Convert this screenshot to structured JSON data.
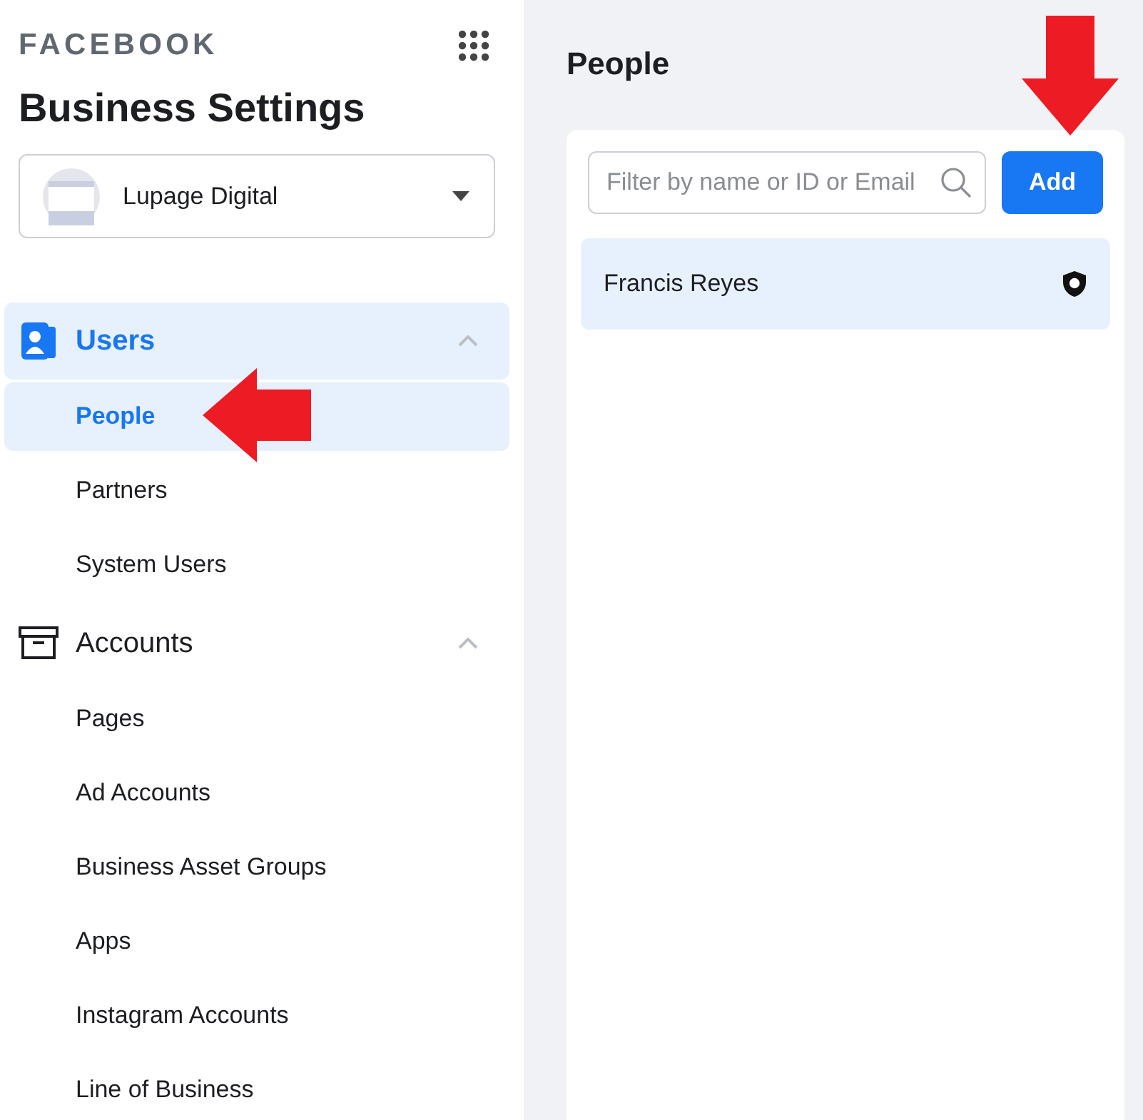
{
  "logo": "FACEBOOK",
  "title": "Business Settings",
  "account": {
    "name": "Lupage Digital"
  },
  "nav": [
    {
      "label": "Users",
      "kind": "users",
      "expanded": true,
      "selected": true,
      "children": [
        {
          "label": "People",
          "selected": true
        },
        {
          "label": "Partners",
          "selected": false
        },
        {
          "label": "System Users",
          "selected": false
        }
      ]
    },
    {
      "label": "Accounts",
      "kind": "accounts",
      "expanded": true,
      "selected": false,
      "children": [
        {
          "label": "Pages",
          "selected": false
        },
        {
          "label": "Ad Accounts",
          "selected": false
        },
        {
          "label": "Business Asset Groups",
          "selected": false
        },
        {
          "label": "Apps",
          "selected": false
        },
        {
          "label": "Instagram Accounts",
          "selected": false
        },
        {
          "label": "Line of Business",
          "selected": false
        }
      ]
    }
  ],
  "main": {
    "heading": "People",
    "search": {
      "placeholder": "Filter by name or ID or Email"
    },
    "add_button": "Add",
    "people": [
      {
        "name": "Francis Reyes",
        "selected": true,
        "admin": true
      }
    ]
  }
}
